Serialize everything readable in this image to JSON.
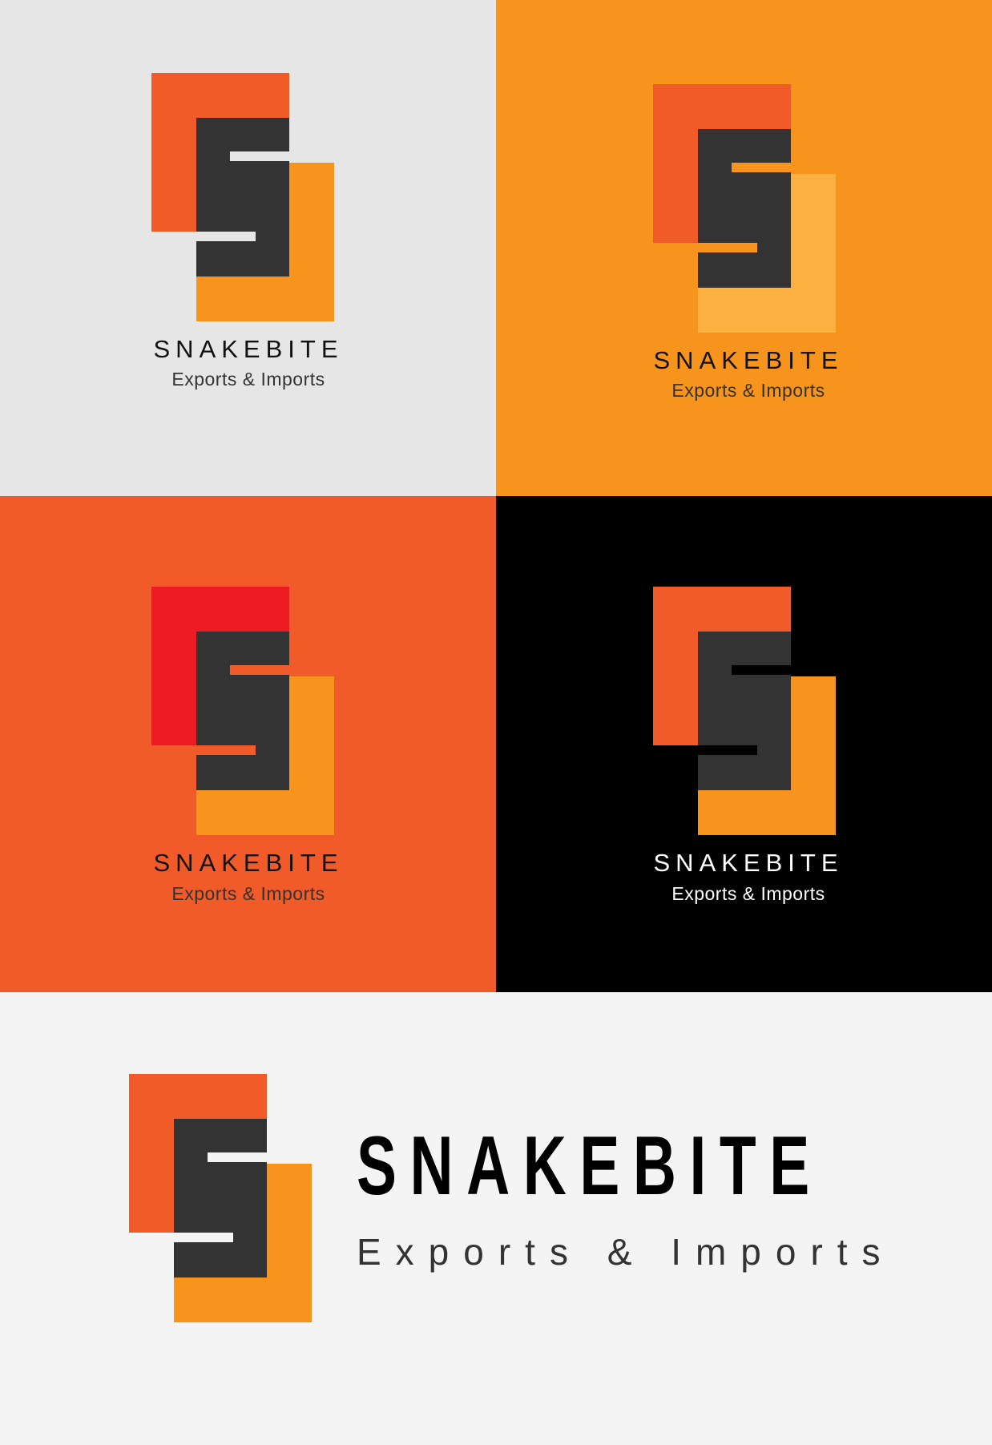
{
  "brand": {
    "name": "SNAKEBITE",
    "tagline": "Exports & Imports"
  },
  "colors": {
    "orange_red": "#F15A29",
    "orange": "#F7941D",
    "light_orange": "#FBB040",
    "red": "#ED1C24",
    "charcoal": "#333333",
    "black": "#000000",
    "light_gray": "#E6E6E6",
    "off_white": "#F4F4F4",
    "white": "#FFFFFF"
  },
  "variants": [
    {
      "background": "#E6E6E6",
      "top_block": "#F15A29",
      "bottom_block": "#F7941D",
      "slot": "#E6E6E6",
      "text_color": "#111111",
      "tag_color": "#333333"
    },
    {
      "background": "#F7941D",
      "top_block": "#F15A29",
      "bottom_block": "#FBB040",
      "slot": "#F7941D",
      "text_color": "#111111",
      "tag_color": "#333333"
    },
    {
      "background": "#F15A29",
      "top_block": "#ED1C24",
      "bottom_block": "#F7941D",
      "slot": "#F15A29",
      "text_color": "#111111",
      "tag_color": "#333333"
    },
    {
      "background": "#000000",
      "top_block": "#F15A29",
      "bottom_block": "#F7941D",
      "slot": "#000000",
      "text_color": "#FFFFFF",
      "tag_color": "#FFFFFF"
    },
    {
      "background": "#F4F4F4",
      "top_block": "#F15A29",
      "bottom_block": "#F7941D",
      "slot": "#F4F4F4",
      "text_color": "#000000",
      "tag_color": "#333333"
    }
  ]
}
